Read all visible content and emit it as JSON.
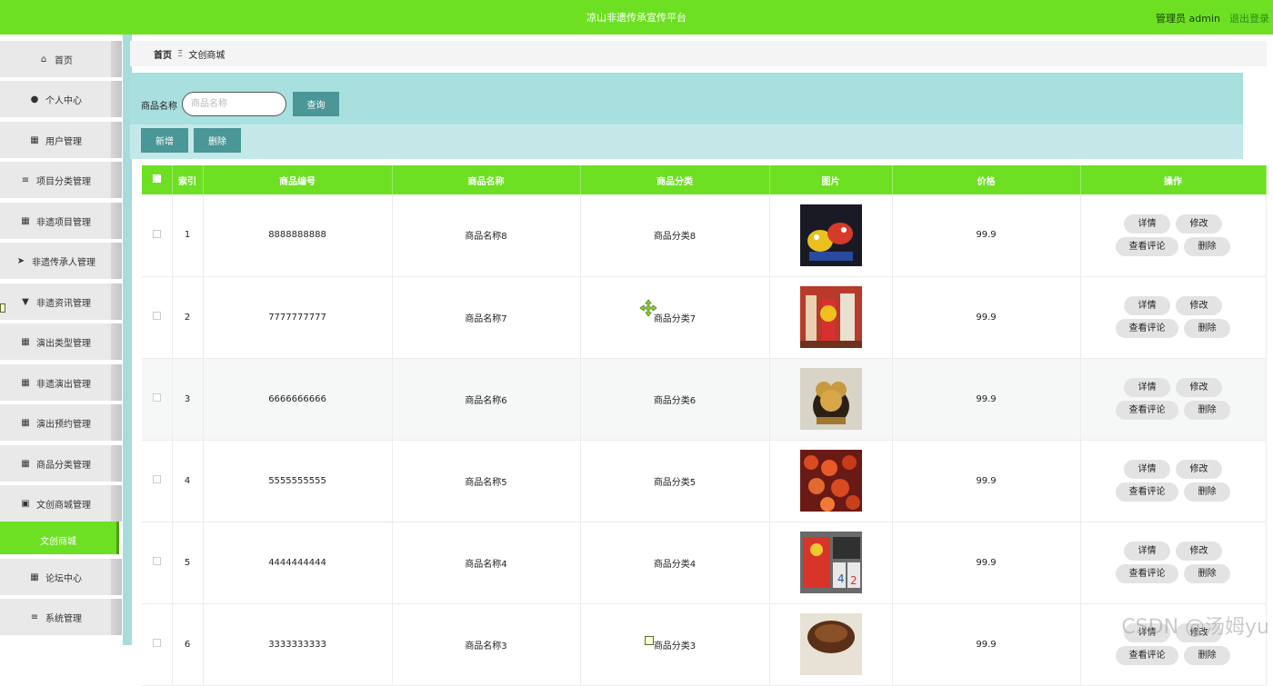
{
  "header": {
    "title": "凉山非遗传承宣传平台",
    "user": "管理员 admin",
    "logout": "退出登录",
    "color": "#6ee024"
  },
  "sidebar": {
    "items": [
      {
        "label": "首页",
        "icon": "home-icon",
        "glyph": "⌂"
      },
      {
        "label": "个人中心",
        "icon": "user-icon",
        "glyph": "●"
      },
      {
        "label": "用户管理",
        "icon": "grid-icon",
        "glyph": "▦"
      },
      {
        "label": "项目分类管理",
        "icon": "list-icon",
        "glyph": "≡"
      },
      {
        "label": "非遗项目管理",
        "icon": "grid-icon",
        "glyph": "▦"
      },
      {
        "label": "非遗传承人管理",
        "icon": "send-icon",
        "glyph": "➤"
      },
      {
        "label": "非遗资讯管理",
        "icon": "flag-icon",
        "glyph": "▼"
      },
      {
        "label": "演出类型管理",
        "icon": "grid-icon",
        "glyph": "▦"
      },
      {
        "label": "非遗演出管理",
        "icon": "grid-icon",
        "glyph": "▦"
      },
      {
        "label": "演出预约管理",
        "icon": "grid-icon",
        "glyph": "▦"
      },
      {
        "label": "商品分类管理",
        "icon": "grid-icon",
        "glyph": "▦"
      },
      {
        "label": "文创商城管理",
        "icon": "clipboard-icon",
        "glyph": "▣"
      },
      {
        "label": "文创商城",
        "icon": "",
        "glyph": "",
        "active": true
      },
      {
        "label": "论坛中心",
        "icon": "grid-icon",
        "glyph": "▦"
      },
      {
        "label": "系统管理",
        "icon": "list-icon",
        "glyph": "≡"
      }
    ]
  },
  "breadcrumb": {
    "home": "首页",
    "separator": "Ξ",
    "current": "文创商城"
  },
  "search": {
    "label": "商品名称",
    "placeholder": "商品名称",
    "button": "查询"
  },
  "actions": {
    "add": "新增",
    "delete": "删除"
  },
  "table": {
    "columns": [
      "",
      "索引",
      "商品编号",
      "商品名称",
      "商品分类",
      "图片",
      "价格",
      "操作"
    ],
    "rows": [
      {
        "index": "1",
        "code": "8888888888",
        "name": "商品名称8",
        "category": "商品分类8",
        "price": "99.9"
      },
      {
        "index": "2",
        "code": "7777777777",
        "name": "商品名称7",
        "category": "商品分类7",
        "price": "99.9"
      },
      {
        "index": "3",
        "code": "6666666666",
        "name": "商品名称6",
        "category": "商品分类6",
        "price": "99.9"
      },
      {
        "index": "4",
        "code": "5555555555",
        "name": "商品名称5",
        "category": "商品分类5",
        "price": "99.9"
      },
      {
        "index": "5",
        "code": "4444444444",
        "name": "商品名称4",
        "category": "商品分类4",
        "price": "99.9"
      },
      {
        "index": "6",
        "code": "3333333333",
        "name": "商品名称3",
        "category": "商品分类3",
        "price": "99.9"
      }
    ],
    "row_buttons": {
      "detail": "详情",
      "edit": "修改",
      "comments": "查看评论",
      "delete": "删除"
    }
  },
  "watermark": "CSDN @汤姆yu"
}
